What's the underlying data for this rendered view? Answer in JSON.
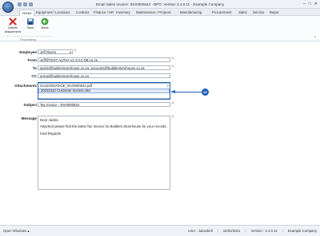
{
  "window": {
    "title": "Email Sales Invoice: INV0000542 - BPO: Version 2.4.0.11 - Example Company",
    "controls": [
      "–",
      "□",
      "✕"
    ]
  },
  "tabs": [
    {
      "label": "Home",
      "active": true
    },
    {
      "label": "Equipment / Locations",
      "active": false
    },
    {
      "label": "Contract",
      "active": false
    },
    {
      "label": "Finance / HR",
      "active": false
    },
    {
      "label": "Inventory",
      "active": false
    },
    {
      "label": "Maintenance / Projects",
      "active": false
    },
    {
      "label": "Manufacturing",
      "active": false
    },
    {
      "label": "Procurement",
      "active": false
    },
    {
      "label": "Sales",
      "active": false
    },
    {
      "label": "Service",
      "active": false
    },
    {
      "label": "Repor",
      "active": false
    }
  ],
  "ribbon": {
    "delete_label": "Delete\nAttachment",
    "save_label": "Save",
    "back_label": "Back",
    "group_label": "Processing"
  },
  "form": {
    "employee_label": "Employee",
    "employee_value": "Jeff Rivers",
    "from_label": "From",
    "from_value": "Jeff@TEST ALPHA v2.4.0.0 DB.co.za",
    "to_label": "To",
    "to_value": "jackie@builderstorehouse.co.za; accounts@builderstorehouse.co.za",
    "cc_label": "CC",
    "cc_value": "group@builderstorehouse.co.za",
    "attachments_label": "Attachments",
    "attachments": [
      "SALESINVOICE_INV0000542.pdf",
      "20210112 Customer Invoice.xlsx"
    ],
    "subject_label": "Subject",
    "subject_value": "Tax Invoice - INV0000542",
    "message_label": "Message",
    "message_lines": [
      "Dear Jackie,",
      "Attached please find the latest Tax Invoice for Builders Storehouse for your records.",
      "Kind Regards"
    ]
  },
  "callout": {
    "number": "32"
  },
  "status": {
    "open_windows": "Open Windows ▴",
    "user": "User : Julianbell",
    "date": "15/03/2021",
    "version": "Version : 2.4.0.11",
    "company": "Example Company"
  },
  "colors": {
    "accent": "#1f5fb8",
    "required": "#cc0000",
    "selection": "#dfe9f7"
  }
}
